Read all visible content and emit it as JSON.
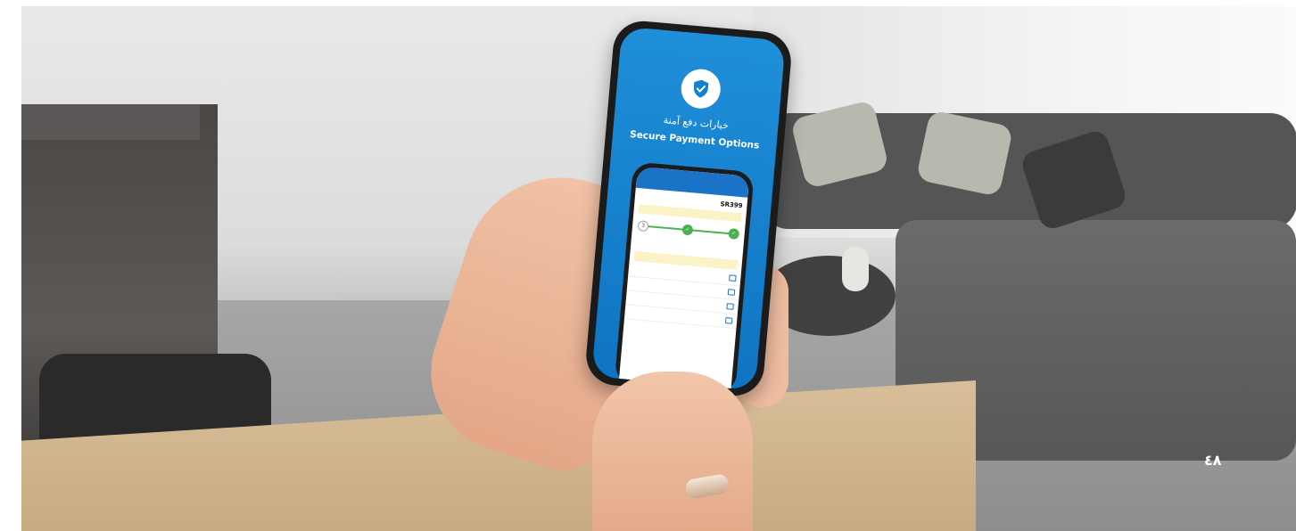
{
  "screen": {
    "hero_title_ar": "خيارات دفع آمنة",
    "hero_title_en": "Secure Payment Options",
    "shield_icon": "shield-check-icon"
  },
  "inner_screen": {
    "amount": "SR399",
    "options": [
      "",
      "",
      "",
      ""
    ]
  },
  "page_number": "٤٨",
  "colors": {
    "brand_blue": "#1481d0",
    "success_green": "#4caf50",
    "note_yellow": "#fbf3c6"
  }
}
